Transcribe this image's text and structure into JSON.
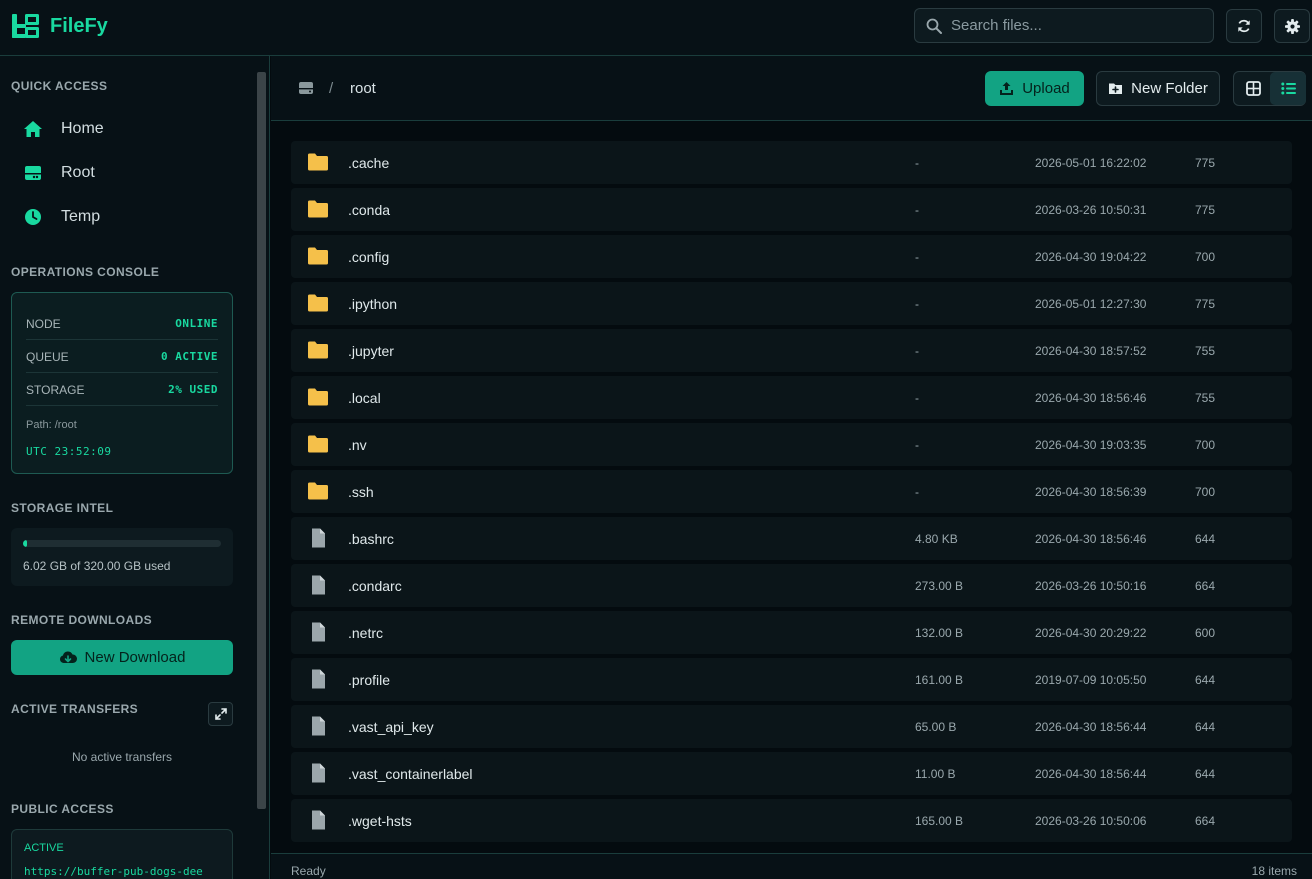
{
  "app": {
    "name": "FileFy"
  },
  "header": {
    "search_placeholder": "Search files..."
  },
  "sidebar": {
    "quick_access_title": "QUICK ACCESS",
    "quick_access": [
      {
        "label": "Home",
        "icon": "home-icon"
      },
      {
        "label": "Root",
        "icon": "drive-icon"
      },
      {
        "label": "Temp",
        "icon": "clock-icon"
      }
    ],
    "ops_title": "OPERATIONS CONSOLE",
    "ops": [
      {
        "key": "NODE",
        "value": "ONLINE"
      },
      {
        "key": "QUEUE",
        "value": "0 ACTIVE"
      },
      {
        "key": "STORAGE",
        "value": "2% USED"
      }
    ],
    "ops_path": "Path: /root",
    "ops_time": "UTC 23:52:09",
    "storage_title": "STORAGE INTEL",
    "storage_used_fraction": 0.019,
    "storage_text": "6.02 GB of 320.00 GB used",
    "remote_title": "REMOTE DOWNLOADS",
    "new_download_label": "New Download",
    "transfers_title": "ACTIVE TRANSFERS",
    "no_transfers": "No active transfers",
    "public_title": "PUBLIC ACCESS",
    "public_status": "ACTIVE",
    "public_url": "https://buffer-pub-dogs-dee"
  },
  "toolbar": {
    "breadcrumb_sep": "/",
    "breadcrumb_root": "root",
    "upload_label": "Upload",
    "new_folder_label": "New Folder"
  },
  "files": [
    {
      "name": ".cache",
      "type": "folder",
      "size": "-",
      "date": "2026-05-01 16:22:02",
      "perm": "775"
    },
    {
      "name": ".conda",
      "type": "folder",
      "size": "-",
      "date": "2026-03-26 10:50:31",
      "perm": "775"
    },
    {
      "name": ".config",
      "type": "folder",
      "size": "-",
      "date": "2026-04-30 19:04:22",
      "perm": "700"
    },
    {
      "name": ".ipython",
      "type": "folder",
      "size": "-",
      "date": "2026-05-01 12:27:30",
      "perm": "775"
    },
    {
      "name": ".jupyter",
      "type": "folder",
      "size": "-",
      "date": "2026-04-30 18:57:52",
      "perm": "755"
    },
    {
      "name": ".local",
      "type": "folder",
      "size": "-",
      "date": "2026-04-30 18:56:46",
      "perm": "755"
    },
    {
      "name": ".nv",
      "type": "folder",
      "size": "-",
      "date": "2026-04-30 19:03:35",
      "perm": "700"
    },
    {
      "name": ".ssh",
      "type": "folder",
      "size": "-",
      "date": "2026-04-30 18:56:39",
      "perm": "700"
    },
    {
      "name": ".bashrc",
      "type": "file",
      "size": "4.80 KB",
      "date": "2026-04-30 18:56:46",
      "perm": "644"
    },
    {
      "name": ".condarc",
      "type": "file",
      "size": "273.00 B",
      "date": "2026-03-26 10:50:16",
      "perm": "664"
    },
    {
      "name": ".netrc",
      "type": "file",
      "size": "132.00 B",
      "date": "2026-04-30 20:29:22",
      "perm": "600"
    },
    {
      "name": ".profile",
      "type": "file",
      "size": "161.00 B",
      "date": "2019-07-09 10:05:50",
      "perm": "644"
    },
    {
      "name": ".vast_api_key",
      "type": "file",
      "size": "65.00 B",
      "date": "2026-04-30 18:56:44",
      "perm": "644"
    },
    {
      "name": ".vast_containerlabel",
      "type": "file",
      "size": "11.00 B",
      "date": "2026-04-30 18:56:44",
      "perm": "644"
    },
    {
      "name": ".wget-hsts",
      "type": "file",
      "size": "165.00 B",
      "date": "2026-03-26 10:50:06",
      "perm": "664"
    }
  ],
  "status": {
    "left": "Ready",
    "right": "18 items"
  },
  "colors": {
    "accent": "#19d9a0",
    "folder": "#f5c04a",
    "file": "#9ba6ab"
  }
}
